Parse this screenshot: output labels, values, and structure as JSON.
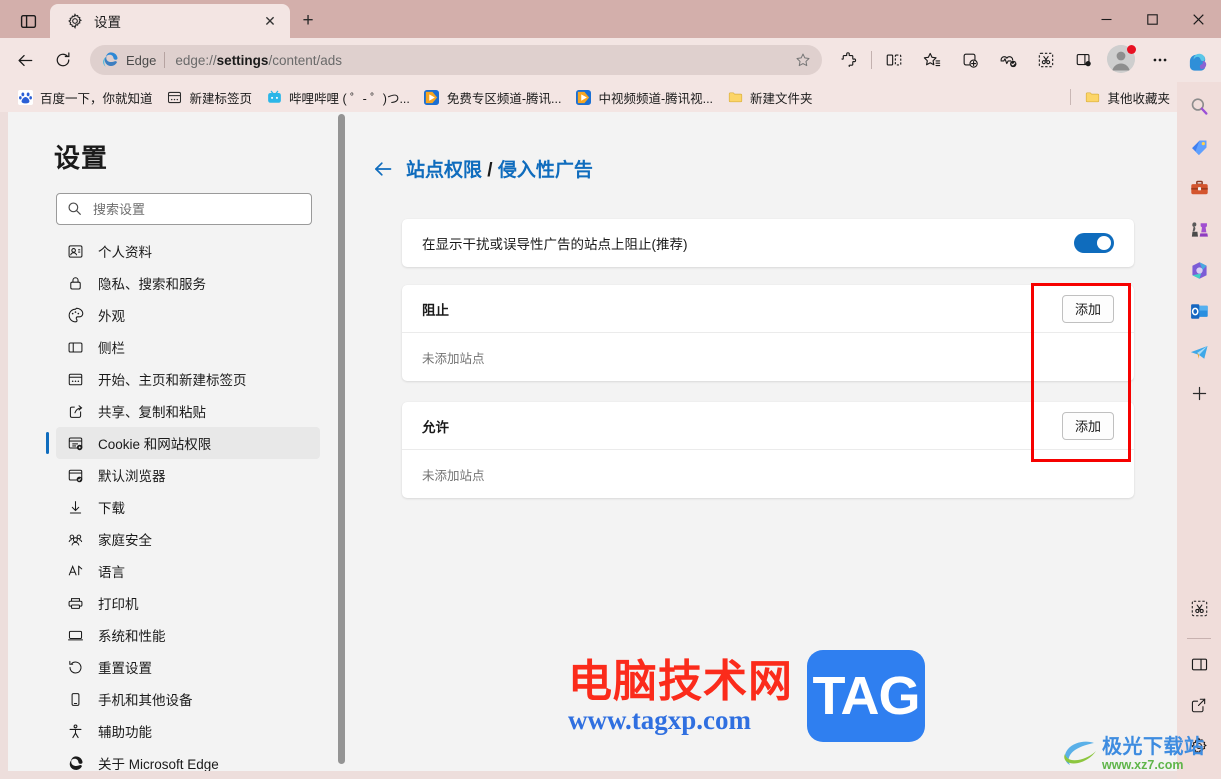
{
  "window": {
    "tab": {
      "title": "设置",
      "favicon": "gear-icon",
      "close_label": "✕"
    },
    "new_tab_label": "+",
    "controls": {
      "minimize": "—",
      "maximize": "▢",
      "close": "✕"
    }
  },
  "toolbar": {
    "back_label": "←",
    "reload_label": "⟳",
    "omnibox": {
      "brand": "Edge",
      "url_prefix": "edge://",
      "url_bold": "settings",
      "url_suffix": "/content/ads",
      "full_url": "edge://settings/content/ads",
      "favorite_icon": "star-icon"
    },
    "icons": [
      "extensions-icon",
      "split-screen-icon",
      "favorites-icon",
      "collections-icon",
      "browser-essentials-icon",
      "screenshot-icon",
      "sidebar-toggle-icon"
    ],
    "profile": "profile-avatar",
    "more_label": "⋯",
    "copilot": "copilot-icon"
  },
  "bookmarks": {
    "items": [
      {
        "label": "百度一下，你就知道",
        "icon": "baidu-icon"
      },
      {
        "label": "新建标签页",
        "icon": "newtab-icon"
      },
      {
        "label": "哔哩哔哩 ( ゜- ゜)つ...",
        "icon": "bilibili-icon"
      },
      {
        "label": "免费专区频道-腾讯...",
        "icon": "tencent-video-icon"
      },
      {
        "label": "中视频频道-腾讯视...",
        "icon": "tencent-video-icon"
      },
      {
        "label": "新建文件夹",
        "icon": "folder-icon"
      }
    ],
    "other": {
      "label": "其他收藏夹",
      "icon": "folder-icon"
    }
  },
  "rail": {
    "top_icons": [
      "search-magnifier-icon",
      "shopping-tag-icon",
      "tools-briefcase-icon",
      "games-chess-icon",
      "microsoft365-icon",
      "outlook-icon",
      "telegram-icon"
    ],
    "add_label": "+",
    "bottom_icons": [
      "screenshot-scissors-icon",
      "split-pane-icon",
      "open-external-icon",
      "settings-gear-icon"
    ]
  },
  "settings_nav": {
    "title": "设置",
    "search": {
      "placeholder": "搜索设置",
      "value": "",
      "icon": "search-icon"
    },
    "items": [
      {
        "label": "个人资料",
        "icon": "profile-icon",
        "selected": false
      },
      {
        "label": "隐私、搜索和服务",
        "icon": "lock-icon",
        "selected": false
      },
      {
        "label": "外观",
        "icon": "palette-icon",
        "selected": false
      },
      {
        "label": "侧栏",
        "icon": "sidebar-icon",
        "selected": false
      },
      {
        "label": "开始、主页和新建标签页",
        "icon": "home-icon",
        "selected": false
      },
      {
        "label": "共享、复制和粘贴",
        "icon": "share-icon",
        "selected": false
      },
      {
        "label": "Cookie 和网站权限",
        "icon": "cookie-icon",
        "selected": true
      },
      {
        "label": "默认浏览器",
        "icon": "default-browser-icon",
        "selected": false
      },
      {
        "label": "下载",
        "icon": "download-icon",
        "selected": false
      },
      {
        "label": "家庭安全",
        "icon": "family-icon",
        "selected": false
      },
      {
        "label": "语言",
        "icon": "language-icon",
        "selected": false
      },
      {
        "label": "打印机",
        "icon": "printer-icon",
        "selected": false
      },
      {
        "label": "系统和性能",
        "icon": "system-icon",
        "selected": false
      },
      {
        "label": "重置设置",
        "icon": "reset-icon",
        "selected": false
      },
      {
        "label": "手机和其他设备",
        "icon": "phone-icon",
        "selected": false
      },
      {
        "label": "辅助功能",
        "icon": "accessibility-icon",
        "selected": false
      },
      {
        "label": "关于 Microsoft Edge",
        "icon": "edge-icon",
        "selected": false
      }
    ]
  },
  "main": {
    "breadcrumb": {
      "back_icon": "back-arrow-icon",
      "parent": "站点权限",
      "separator": " / ",
      "current": "侵入性广告"
    },
    "setting_row": {
      "label": "在显示干扰或误导性广告的站点上阻止(推荐)",
      "toggle_on": true
    },
    "block_section": {
      "title": "阻止",
      "add_label": "添加",
      "empty": "未添加站点"
    },
    "allow_section": {
      "title": "允许",
      "add_label": "添加",
      "empty": "未添加站点"
    },
    "highlight_color": "#f60100"
  },
  "watermarks": {
    "tagxp": {
      "cn": "电脑技术网",
      "url": "www.tagxp.com",
      "badge": "TAG"
    },
    "jiguang": {
      "cn": "极光下载站",
      "url": "www.xz7.com"
    }
  },
  "colors": {
    "titlebar": "#d3afab",
    "toolbar": "#f3e5e3",
    "accent": "#0f6cbd",
    "page_bg": "#f3f3f3"
  }
}
